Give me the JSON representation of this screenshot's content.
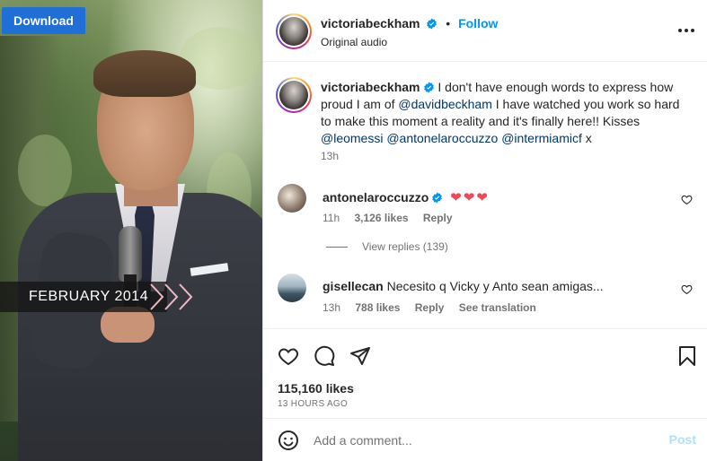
{
  "overlay": {
    "download_label": "Download",
    "banner_text": "FEBRUARY 2014"
  },
  "header": {
    "username": "victoriabeckham",
    "separator": "•",
    "follow_label": "Follow",
    "audio_label": "Original audio"
  },
  "caption": {
    "username": "victoriabeckham",
    "text_1": "I don't have enough words to express how proud I am of",
    "mention_1": "@davidbeckham",
    "text_2": "I have watched you work so hard to make this moment a reality and it's finally here!! Kisses",
    "mention_2": "@leomessi",
    "mention_3": "@antonelaroccuzzo",
    "mention_4": "@intermiamicf",
    "text_3": "x",
    "time": "13h"
  },
  "comments": [
    {
      "username": "antonelaroccuzzo",
      "text": "❤❤❤",
      "time": "11h",
      "likes": "3,126 likes",
      "reply_label": "Reply",
      "view_replies": "View replies (139)"
    },
    {
      "username": "gisellecan",
      "text": "Necesito q Vicky y Anto sean amigas...",
      "time": "13h",
      "likes": "788 likes",
      "reply_label": "Reply",
      "translate_label": "See translation"
    }
  ],
  "stats": {
    "likes": "115,160 likes",
    "posted": "13 HOURS AGO"
  },
  "composer": {
    "placeholder": "Add a comment...",
    "post_label": "Post"
  },
  "colors": {
    "accent": "#0095f6",
    "download": "#1f6fd6",
    "heart": "#ed4956"
  }
}
